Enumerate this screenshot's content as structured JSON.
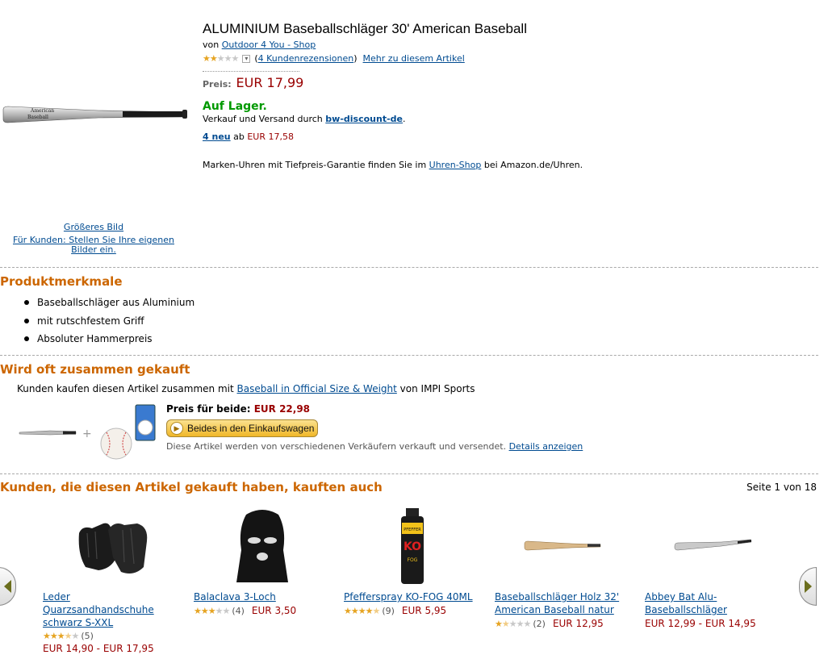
{
  "product": {
    "title": "ALUMINIUM Baseballschläger 30' American Baseball",
    "by_label": "von",
    "seller_link": "Outdoor 4 You - Shop",
    "rating_stars": 2,
    "reviews_link": "4 Kundenrezensionen",
    "more_link": "Mehr zu diesem Artikel",
    "price_label": "Preis:",
    "price_value": "EUR 17,99",
    "stock": "Auf Lager.",
    "shipping_prefix": "Verkauf und Versand durch",
    "shipping_seller": "bw-discount-de",
    "new_offers_link": "4 neu",
    "new_offers_mid": "ab",
    "new_offers_price": "EUR 17,58",
    "promo_pre": "Marken-Uhren mit Tiefpreis-Garantie finden Sie im",
    "promo_link": "Uhren-Shop",
    "promo_post": "bei Amazon.de/Uhren.",
    "bigger_image": "Größeres Bild",
    "upload_line1": "Für Kunden: Stellen Sie Ihre eigenen",
    "upload_line2": "Bilder ein."
  },
  "features": {
    "title": "Produktmerkmale",
    "items": [
      "Baseballschläger aus Aluminium",
      "mit rutschfestem Griff",
      "Absoluter Hammerpreis"
    ]
  },
  "bundle": {
    "title": "Wird oft zusammen gekauft",
    "text_pre": "Kunden kaufen diesen Artikel zusammen mit",
    "text_link": "Baseball in Official Size & Weight",
    "text_post": "von IMPI Sports",
    "price_label": "Preis für beide:",
    "price_value": "EUR 22,98",
    "button": "Beides in den Einkaufswagen",
    "note": "Diese Artikel werden von verschiedenen Verkäufern verkauft und versendet.",
    "details_link": "Details anzeigen"
  },
  "also_bought": {
    "title": "Kunden, die diesen Artikel gekauft haben, kauften auch",
    "page": "Seite 1 von 18",
    "items": [
      {
        "name": "Leder Quarzsandhandschuhe schwarz S-XXL",
        "stars": 3.5,
        "count": "(5)",
        "price": "EUR 14,90 - EUR 17,95",
        "icon": "gloves-image"
      },
      {
        "name": "Balaclava 3-Loch",
        "stars": 3,
        "count": "(4)",
        "price": "EUR 3,50",
        "icon": "balaclava-image"
      },
      {
        "name": "Pfefferspray KO-FOG 40ML",
        "stars": 4.5,
        "count": "(9)",
        "price": "EUR 5,95",
        "icon": "pepper-spray-image"
      },
      {
        "name": "Baseballschläger Holz 32' American Baseball natur",
        "stars": 1.5,
        "count": "(2)",
        "price": "EUR 12,95",
        "icon": "wooden-bat-image"
      },
      {
        "name": "Abbey Bat Alu-Baseballschläger",
        "stars": 0,
        "count": "",
        "price": "EUR 12,99 - EUR 14,95",
        "icon": "alu-bat-image"
      }
    ]
  },
  "colors": {
    "section_title": "#cc6600",
    "price": "#990000",
    "stock": "#009900",
    "link": "#004b91"
  }
}
